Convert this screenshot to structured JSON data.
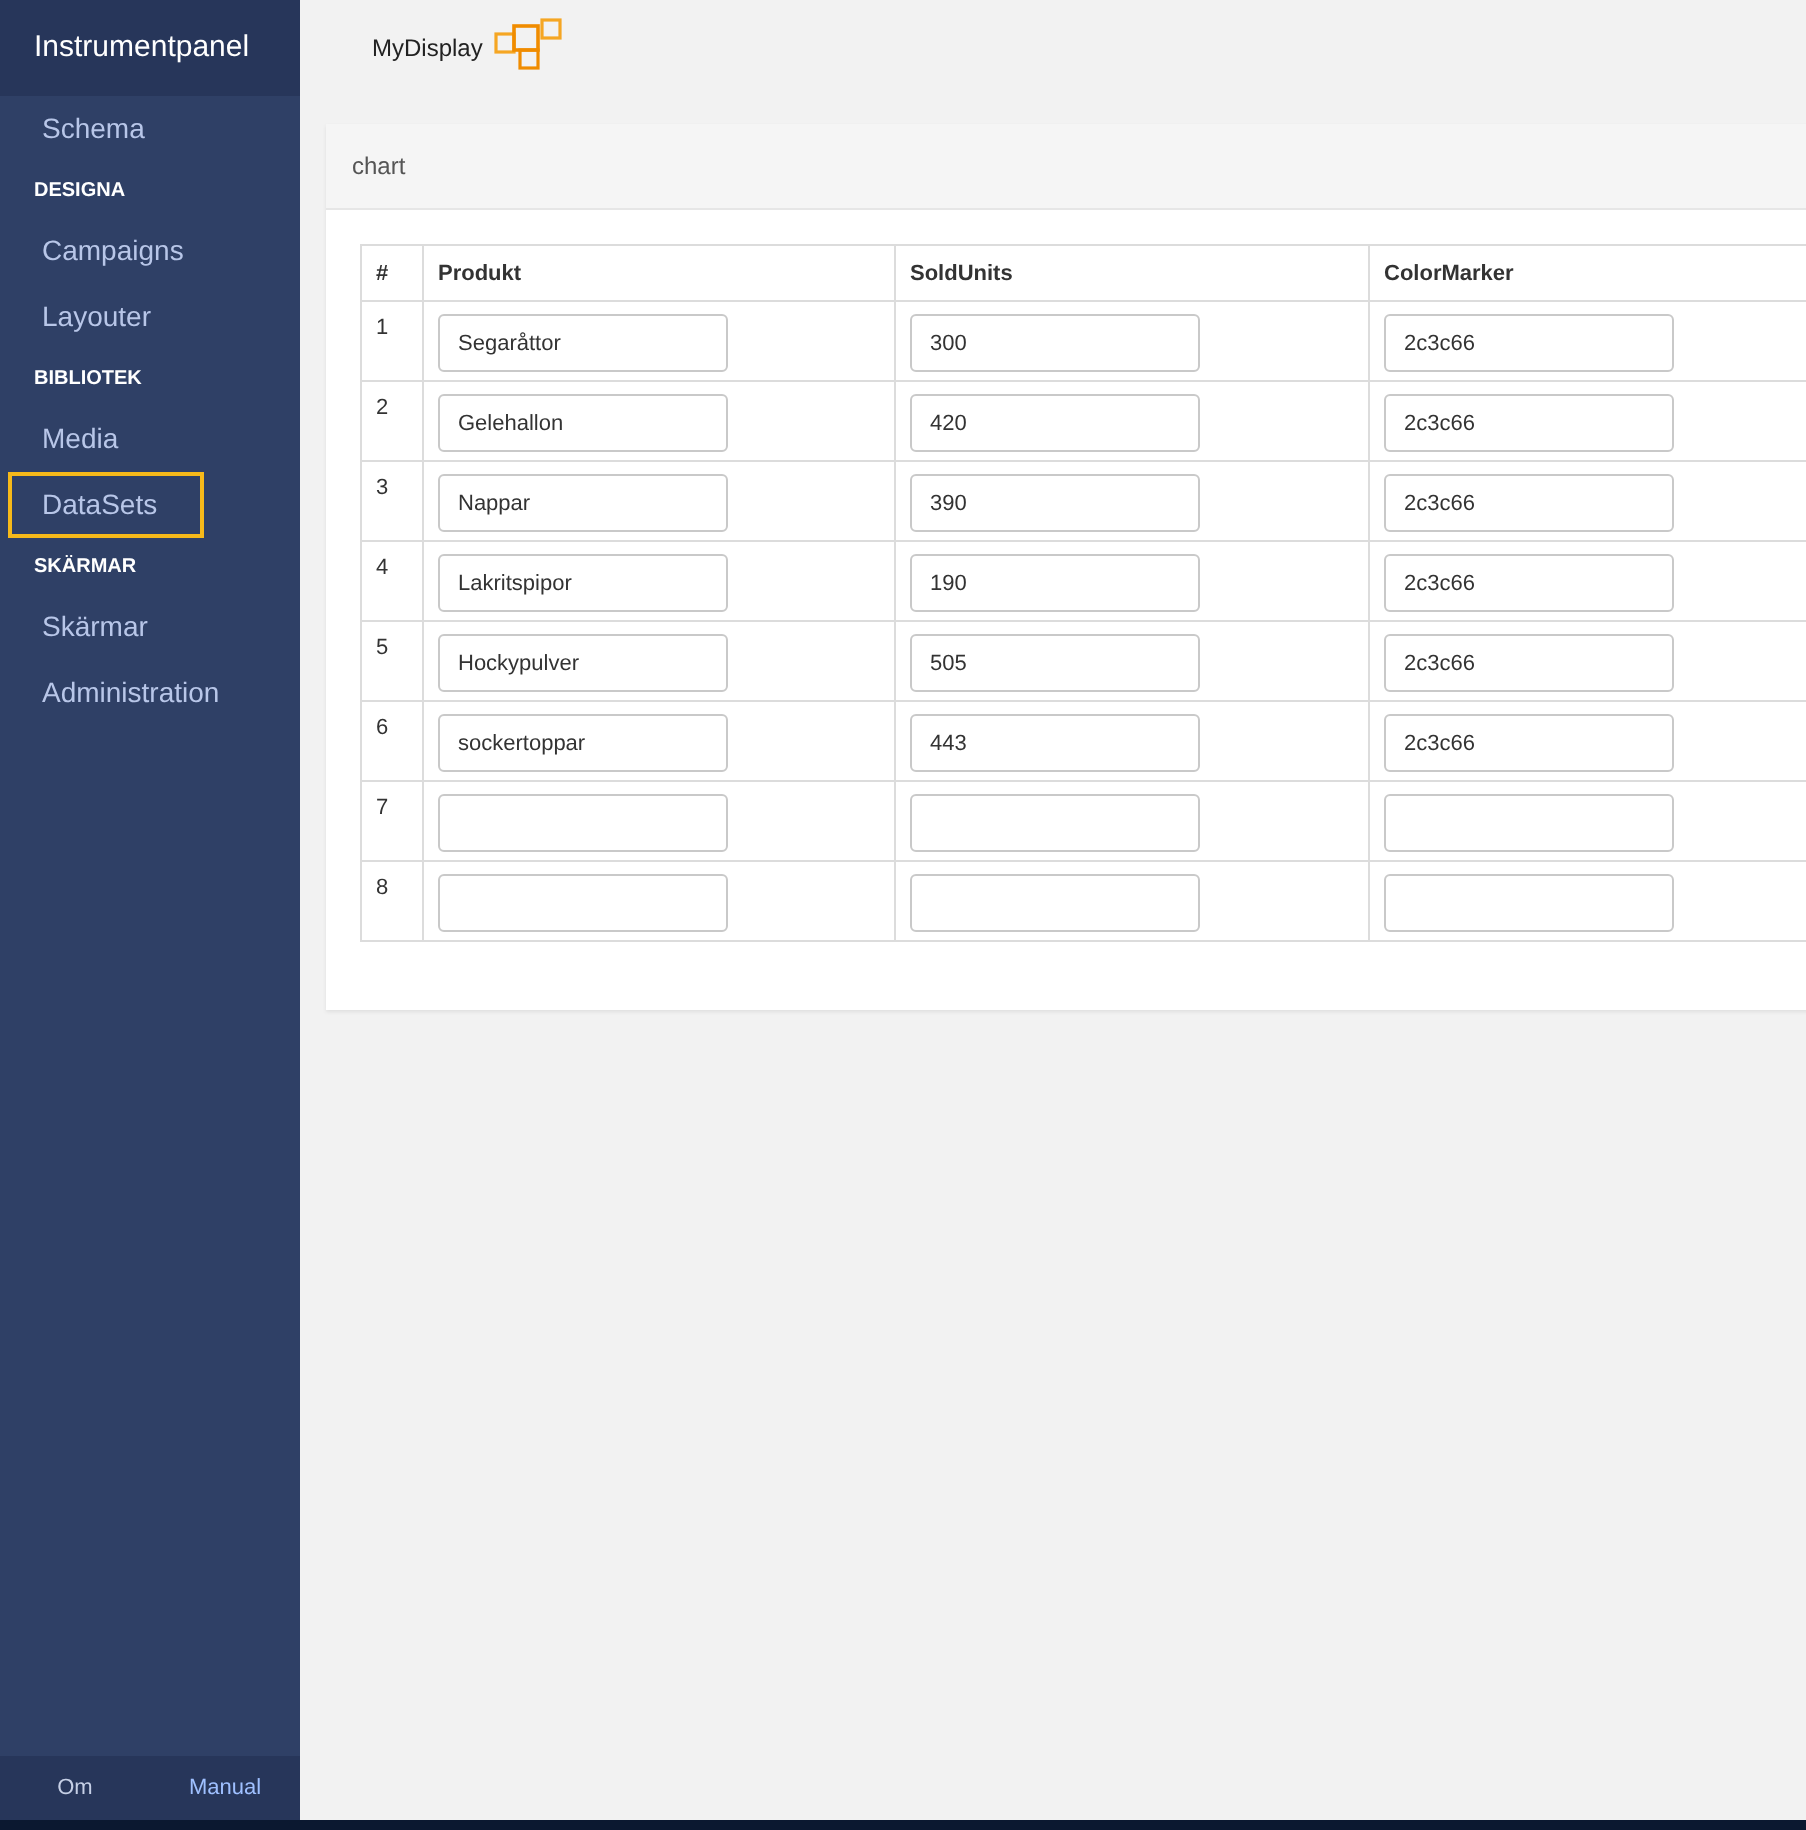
{
  "sidebar": {
    "title": "Instrumentpanel",
    "sections": [
      {
        "items": [
          {
            "label": "Schema",
            "selected": false
          }
        ]
      },
      {
        "heading": "DESIGNA",
        "items": [
          {
            "label": "Campaigns",
            "selected": false
          },
          {
            "label": "Layouter",
            "selected": false
          }
        ]
      },
      {
        "heading": "BIBLIOTEK",
        "items": [
          {
            "label": "Media",
            "selected": false
          },
          {
            "label": "DataSets",
            "selected": true
          }
        ]
      },
      {
        "heading": "SKÄRMAR",
        "items": [
          {
            "label": "Skärmar",
            "selected": false
          },
          {
            "label": "Administration",
            "selected": false
          }
        ]
      }
    ],
    "footer": [
      {
        "label": "Om",
        "kind": "plain"
      },
      {
        "label": "Manual",
        "kind": "link"
      }
    ]
  },
  "header": {
    "brand": "MyDisplay"
  },
  "panel": {
    "title": "chart",
    "table": {
      "columns": [
        "#",
        "Produkt",
        "SoldUnits",
        "ColorMarker"
      ],
      "rows": [
        {
          "number": "1",
          "values": [
            "Segaråttor",
            "300",
            "2c3c66"
          ]
        },
        {
          "number": "2",
          "values": [
            "Gelehallon",
            "420",
            "2c3c66"
          ]
        },
        {
          "number": "3",
          "values": [
            "Nappar",
            "390",
            "2c3c66"
          ]
        },
        {
          "number": "4",
          "values": [
            "Lakritspipor",
            "190",
            "2c3c66"
          ]
        },
        {
          "number": "5",
          "values": [
            "Hockypulver",
            "505",
            "2c3c66"
          ]
        },
        {
          "number": "6",
          "values": [
            "sockertoppar",
            "443",
            "2c3c66"
          ]
        },
        {
          "number": "7"
        },
        {
          "number": "8"
        }
      ]
    }
  }
}
